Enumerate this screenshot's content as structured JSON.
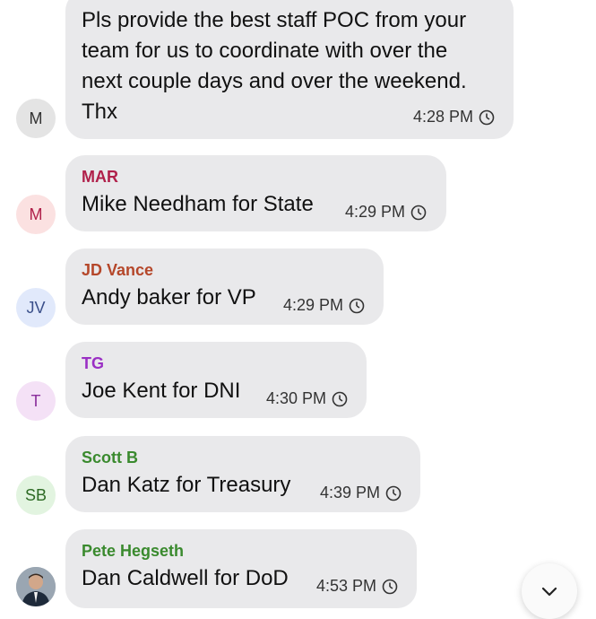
{
  "messages": [
    {
      "avatar": "M",
      "sender": "",
      "lines": [
        "Pls provide the best staff POC from your",
        "team for us to coordinate with over the",
        "next couple days and over the weekend.",
        "Thx"
      ],
      "time": "4:28 PM"
    },
    {
      "avatar": "M",
      "sender": "MAR",
      "lines": [
        "Mike Needham for State"
      ],
      "time": "4:29 PM"
    },
    {
      "avatar": "JV",
      "sender": "JD Vance",
      "lines": [
        "Andy baker for VP"
      ],
      "time": "4:29 PM"
    },
    {
      "avatar": "T",
      "sender": "TG",
      "lines": [
        "Joe Kent for DNI"
      ],
      "time": "4:30 PM"
    },
    {
      "avatar": "SB",
      "sender": "Scott B",
      "lines": [
        "Dan Katz for Treasury"
      ],
      "time": "4:39 PM"
    },
    {
      "avatar": "",
      "sender": "Pete Hegseth",
      "lines": [
        "Dan Caldwell for DoD"
      ],
      "time": "4:53 PM"
    }
  ],
  "colors": {
    "bubble": "#e9e9eb",
    "mar": "#b0204a",
    "jd_vance": "#b5472a",
    "tg": "#9a2fc4",
    "scott_b": "#3a8a2e",
    "pete_hegseth": "#3a8a2e"
  },
  "icons": {
    "clock": "clock-icon",
    "scroll": "chevron-down-icon"
  }
}
